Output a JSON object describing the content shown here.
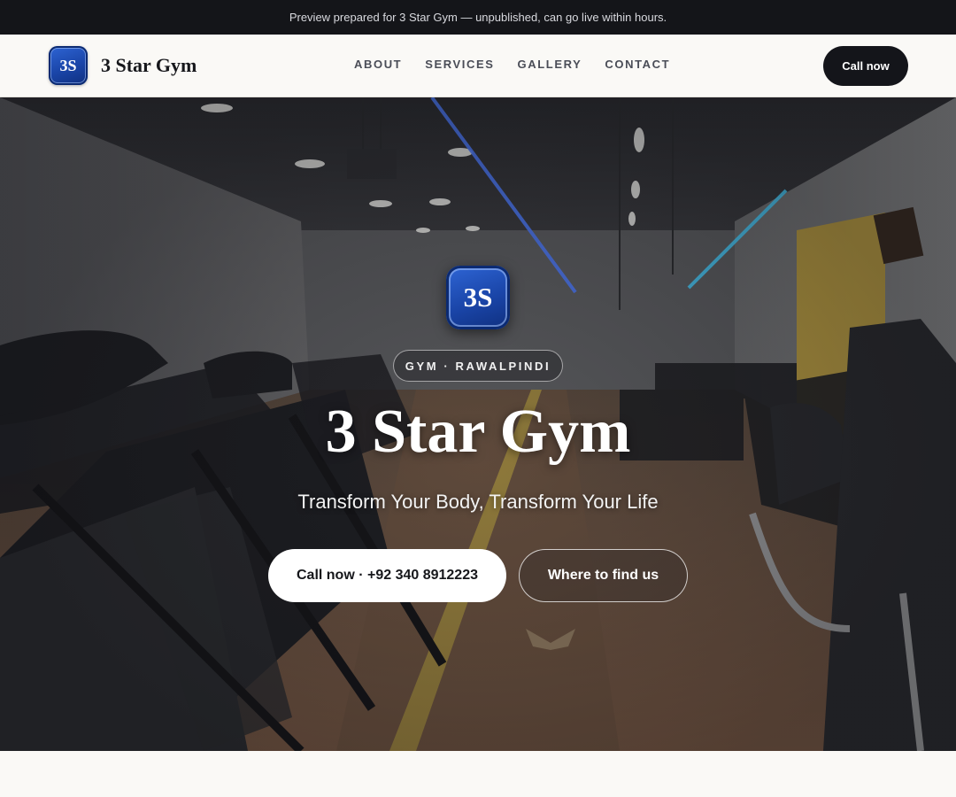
{
  "banner": {
    "text": "Preview prepared for 3 Star Gym — unpublished, can go live within hours."
  },
  "header": {
    "logo_initials": "3S",
    "brand_name": "3 Star Gym",
    "nav": [
      {
        "label": "ABOUT"
      },
      {
        "label": "SERVICES"
      },
      {
        "label": "GALLERY"
      },
      {
        "label": "CONTACT"
      }
    ],
    "call_label": "Call now"
  },
  "hero": {
    "badge_initials": "3S",
    "tag": "GYM · RAWALPINDI",
    "title": "3 Star Gym",
    "subtitle": "Transform Your Body, Transform Your Life",
    "primary_button": "Call now · +92 340 8912223",
    "secondary_button": "Where to find us",
    "scroll_icon": "chevron-down-icon"
  },
  "colors": {
    "banner_bg": "#141519",
    "nav_bg": "#faf9f6",
    "dark_button": "#14151a",
    "logo_blue": "#1a45a8",
    "accent_neon": "#3a6cff"
  }
}
